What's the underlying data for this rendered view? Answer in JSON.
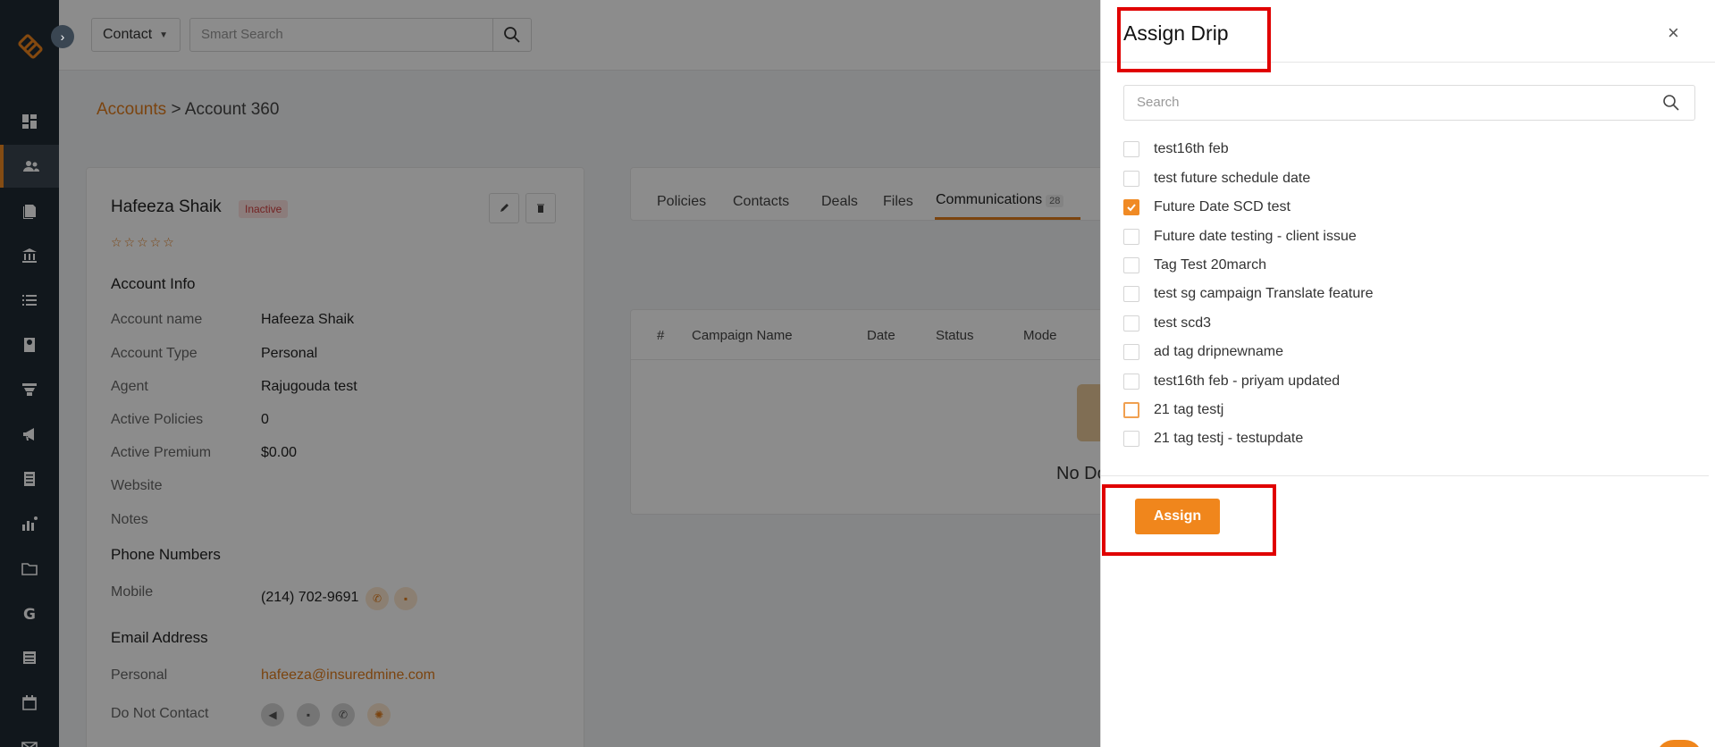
{
  "topbar": {
    "contact_select": "Contact",
    "search_placeholder": "Smart Search"
  },
  "breadcrumb": {
    "parent": "Accounts",
    "separator": ">",
    "current": "Account 360"
  },
  "account": {
    "name": "Hafeeza Shaik",
    "status": "Inactive",
    "stars": "☆☆☆☆☆",
    "info_title": "Account Info",
    "fields": [
      {
        "label": "Account name",
        "value": "Hafeeza Shaik"
      },
      {
        "label": "Account Type",
        "value": "Personal"
      },
      {
        "label": "Agent",
        "value": "Rajugouda test"
      },
      {
        "label": "Active Policies",
        "value": "0"
      },
      {
        "label": "Active Premium",
        "value": "$0.00"
      },
      {
        "label": "Website",
        "value": ""
      },
      {
        "label": "Notes",
        "value": ""
      }
    ],
    "phone_title": "Phone Numbers",
    "phone_label": "Mobile",
    "phone_value": "(214) 702-9691",
    "email_title": "Email Address",
    "email_label": "Personal",
    "email_value": "hafeeza@insuredmine.com",
    "dnc_label": "Do Not Contact"
  },
  "tabs": [
    {
      "label": "Policies"
    },
    {
      "label": "Contacts"
    },
    {
      "label": "Deals"
    },
    {
      "label": "Files"
    },
    {
      "label": "Communications",
      "count": "28"
    }
  ],
  "table": {
    "columns": [
      "#",
      "Campaign Name",
      "Date",
      "Status",
      "Mode"
    ],
    "empty_text": "No Do"
  },
  "drawer": {
    "title": "Assign Drip",
    "close": "×",
    "search_placeholder": "Search",
    "items": [
      {
        "label": "test16th feb",
        "checked": false
      },
      {
        "label": "test future schedule date",
        "checked": false
      },
      {
        "label": "Future Date SCD test",
        "checked": true
      },
      {
        "label": "Future date testing - client issue",
        "checked": false
      },
      {
        "label": "Tag Test 20march",
        "checked": false
      },
      {
        "label": "test sg campaign Translate feature",
        "checked": false
      },
      {
        "label": "test scd3",
        "checked": false
      },
      {
        "label": "ad tag dripnewname",
        "checked": false
      },
      {
        "label": "test16th feb - priyam updated",
        "checked": false
      },
      {
        "label": "21 tag testj",
        "checked": false
      },
      {
        "label": "21 tag testj - testupdate",
        "checked": false
      }
    ],
    "assign_label": "Assign"
  },
  "colors": {
    "accent": "#f0861c",
    "sidebar": "#1f2a33",
    "highlight": "#e00000"
  }
}
